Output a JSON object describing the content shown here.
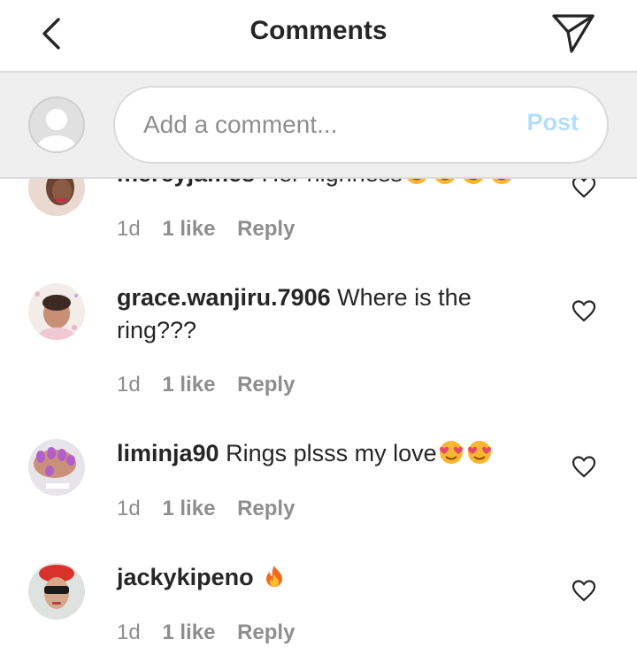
{
  "header": {
    "title": "Comments",
    "back_icon": "chevron-left-icon",
    "send_icon": "paper-plane-icon"
  },
  "composer": {
    "placeholder": "Add a comment...",
    "post_label": "Post",
    "post_color": "#b2dffc"
  },
  "colors": {
    "text": "#262626",
    "muted": "#8e8e8e",
    "divider": "#dbdbdb",
    "composer_bg": "#efefef"
  },
  "comments": [
    {
      "username": "mercyjames",
      "text": "Her highness",
      "time": "1d",
      "likes": "1 like",
      "reply": "Reply",
      "emojis": [
        "heart-eyes-emoji",
        "heart-eyes-emoji",
        "heart-eyes-emoji",
        "heart-eyes-emoji"
      ]
    },
    {
      "username": "grace.wanjiru.7906",
      "text": "Where is the ring???",
      "time": "1d",
      "likes": "1 like",
      "reply": "Reply",
      "emojis": []
    },
    {
      "username": "liminja90",
      "text": "Rings plsss my love",
      "time": "1d",
      "likes": "1 like",
      "reply": "Reply",
      "emojis": [
        "heart-eyes-emoji",
        "heart-eyes-emoji"
      ]
    },
    {
      "username": "jackykipeno",
      "text": "",
      "time": "1d",
      "likes": "1 like",
      "reply": "Reply",
      "emojis": [
        "fire-emoji"
      ]
    }
  ]
}
